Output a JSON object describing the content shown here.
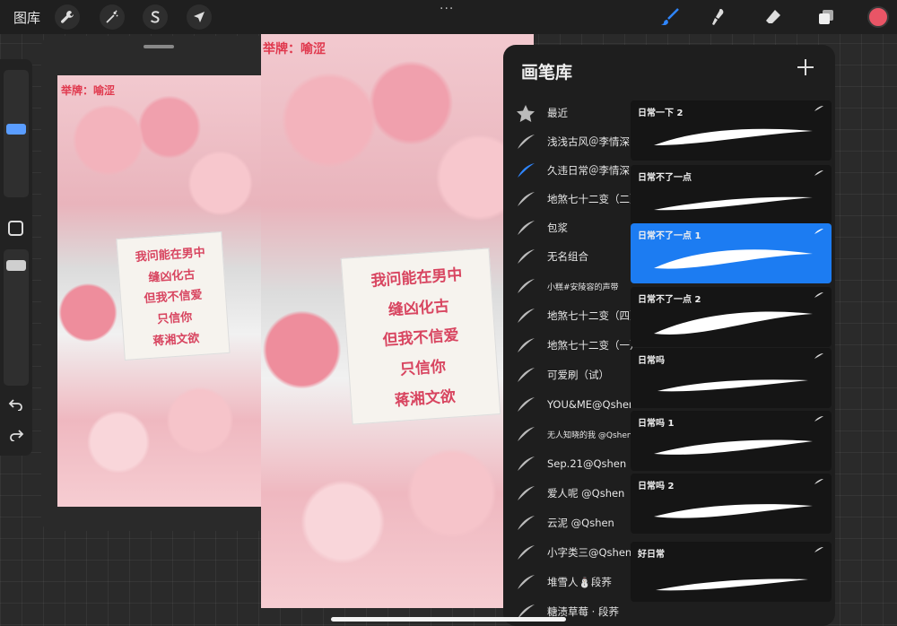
{
  "topbar": {
    "gallery_label": "图库",
    "more_icon": "···",
    "color": "#e95566"
  },
  "reference": {
    "label": "举牌：喻涩",
    "note_lines": [
      "我问能在男中",
      "缝凶化古",
      "但我不信爱",
      "只信你",
      "蒋湘文欲"
    ]
  },
  "canvas": {
    "label": "举牌：喻涩",
    "note_lines": [
      "我问能在男中",
      "缝凶化古",
      "但我不信爱",
      "只信你",
      "蒋湘文欲"
    ]
  },
  "brush_library": {
    "title": "画笔库",
    "sets": [
      {
        "label": "最近",
        "icon": "star-icon",
        "active": false
      },
      {
        "label": "浅浅古风＠李情深",
        "icon": "brush-stroke-icon",
        "active": false
      },
      {
        "label": "久违日常＠李情深",
        "icon": "brush-stroke-icon",
        "active": true
      },
      {
        "label": "地煞七十二变（二）",
        "icon": "brush-stroke-icon",
        "active": false
      },
      {
        "label": "包浆",
        "icon": "brush-stroke-icon",
        "active": false
      },
      {
        "label": "无名组合",
        "icon": "brush-stroke-icon",
        "active": false
      },
      {
        "label": "小糕#安陵容的声带",
        "icon": "brush-stroke-icon",
        "active": false
      },
      {
        "label": "地煞七十二变（四）",
        "icon": "brush-stroke-icon",
        "active": false
      },
      {
        "label": "地煞七十二变（一）",
        "icon": "brush-stroke-icon",
        "active": false
      },
      {
        "label": "可爱刷（试）",
        "icon": "brush-stroke-icon",
        "active": false
      },
      {
        "label": "YOU&ME@Qshen",
        "icon": "brush-stroke-icon",
        "active": false
      },
      {
        "label": "无人知晓的我 @Qshen",
        "icon": "brush-stroke-icon",
        "active": false
      },
      {
        "label": "Sep.21@Qshen",
        "icon": "brush-stroke-icon",
        "active": false
      },
      {
        "label": "爱人呢 @Qshen",
        "icon": "brush-stroke-icon",
        "active": false
      },
      {
        "label": "云泥 @Qshen",
        "icon": "brush-stroke-icon",
        "active": false
      },
      {
        "label": "小字类三@Qshen",
        "icon": "brush-stroke-icon",
        "active": false
      },
      {
        "label": "堆雪人⛄段荞",
        "icon": "brush-stroke-icon",
        "active": false
      },
      {
        "label": "糖渍草莓 · 段荞",
        "icon": "brush-stroke-icon",
        "active": false
      }
    ],
    "brushes": [
      {
        "name": "日常一下 2",
        "selected": false
      },
      {
        "name": "日常不了一点",
        "selected": false
      },
      {
        "name": "日常不了一点 1",
        "selected": true
      },
      {
        "name": "日常不了一点 2",
        "selected": false
      },
      {
        "name": "日常吗",
        "selected": false
      },
      {
        "name": "日常吗 1",
        "selected": false
      },
      {
        "name": "日常吗 2",
        "selected": false
      },
      {
        "name": "好日常",
        "selected": false
      }
    ],
    "selected_color": "#1c7cf2"
  }
}
